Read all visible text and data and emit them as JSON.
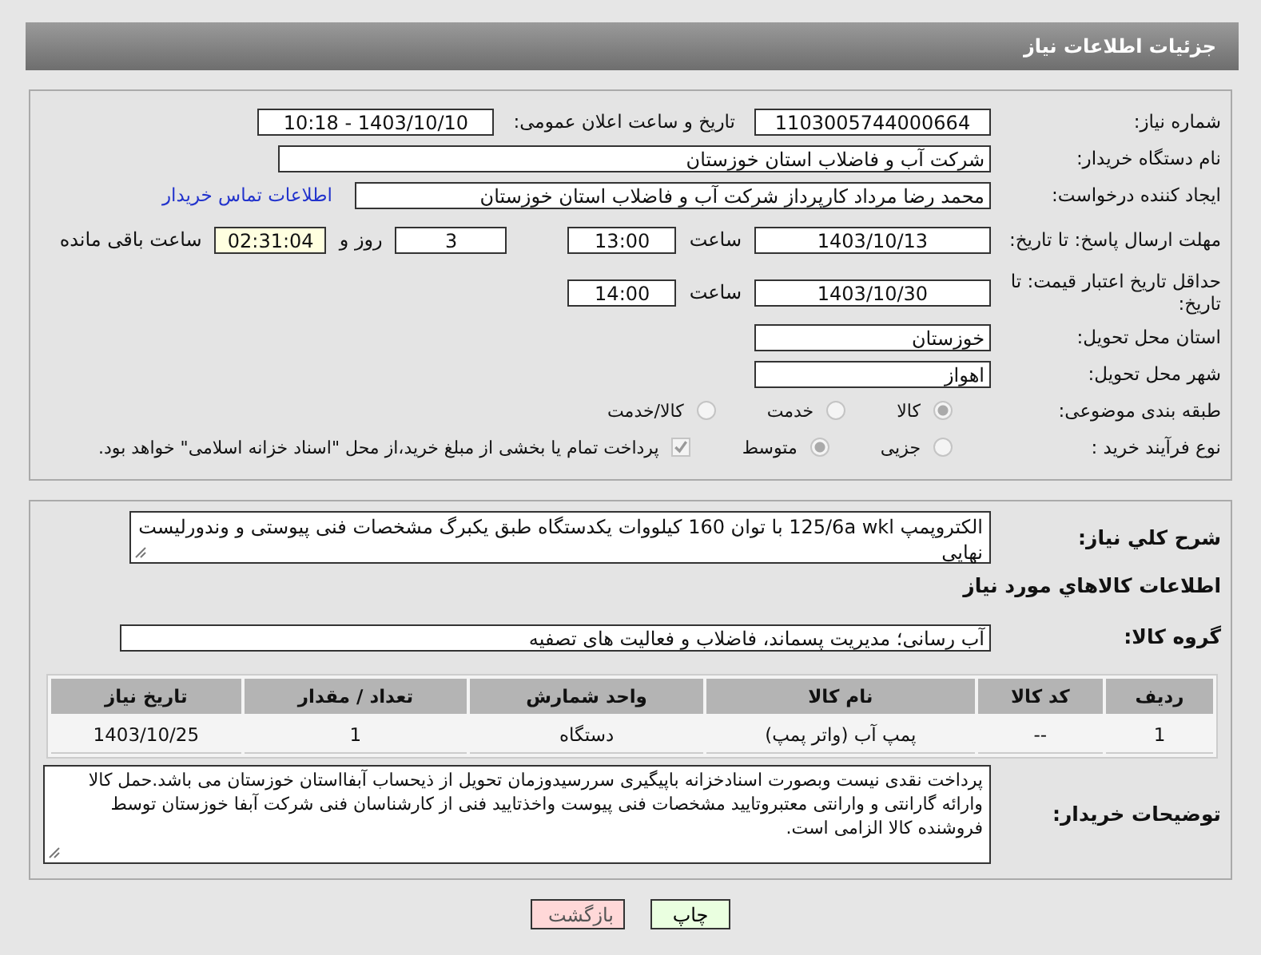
{
  "title": "جزئیات اطلاعات نیاز",
  "need_number": {
    "label": "شماره نیاز:",
    "value": "1103005744000664"
  },
  "announce": {
    "label": "تاریخ و ساعت اعلان عمومی:",
    "value": "1403/10/10 - 10:18"
  },
  "buyer_org": {
    "label": "نام دستگاه خریدار:",
    "value": "شرکت آب و فاضلاب استان خوزستان"
  },
  "requester": {
    "label": "ایجاد کننده درخواست:",
    "value": "محمد رضا مرداد کارپرداز شرکت آب و فاضلاب استان خوزستان",
    "link": "اطلاعات تماس خریدار"
  },
  "deadline": {
    "label": "مهلت ارسال پاسخ: تا تاریخ:",
    "date": "1403/10/13",
    "time_label": "ساعت",
    "time": "13:00",
    "days": "3",
    "days_label": "روز و",
    "remaining": "02:31:04",
    "remaining_label": "ساعت باقی مانده"
  },
  "validity": {
    "label": "حداقل تاریخ اعتبار قیمت: تا تاریخ:",
    "date": "1403/10/30",
    "time_label": "ساعت",
    "time": "14:00"
  },
  "province": {
    "label": "استان محل تحویل:",
    "value": "خوزستان"
  },
  "city": {
    "label": "شهر محل تحویل:",
    "value": "اهواز"
  },
  "category": {
    "label": "طبقه بندی موضوعی:",
    "options": [
      {
        "label": "کالا",
        "selected": true
      },
      {
        "label": "خدمت",
        "selected": false
      },
      {
        "label": "کالا/خدمت",
        "selected": false
      }
    ]
  },
  "process": {
    "label": "نوع فرآیند خرید :",
    "options": [
      {
        "label": "جزیی",
        "selected": false
      },
      {
        "label": "متوسط",
        "selected": true
      }
    ],
    "treasury": {
      "label": "پرداخت تمام یا بخشی از مبلغ خرید،از محل \"اسناد خزانه اسلامی\" خواهد بود.",
      "checked": true
    }
  },
  "description": {
    "label": "شرح کلي نياز:",
    "value": "الکتروپمپ 125/6a wkl با توان 160 کیلووات یکدستگاه طبق یکبرگ مشخصات فنی پیوستی و وندورلیست نهایی"
  },
  "goods_heading": "اطلاعات کالاهاي مورد نياز",
  "goods_group": {
    "label": "گروه کالا:",
    "value": "آب رسانی؛ مدیریت پسماند، فاضلاب و فعالیت های تصفیه"
  },
  "table": {
    "columns": [
      "ردیف",
      "کد کالا",
      "نام کالا",
      "واحد شمارش",
      "تعداد / مقدار",
      "تاریخ نیاز"
    ],
    "rows": [
      [
        "1",
        "--",
        "پمپ آب (واتر پمپ)",
        "دستگاه",
        "1",
        "1403/10/25"
      ]
    ]
  },
  "buyer_notes": {
    "label": "توضیحات خریدار:",
    "value": "پرداخت نقدی نیست وبصورت اسنادخزانه باپیگیری سررسیدوزمان تحویل از ذیحساب آبفااستان خوزستان می باشد.حمل کالا وارائه گارانتی و وارانتی معتبروتایید مشخصات فنی پیوست واخذتایید فنی از کارشناسان فنی شرکت آبفا خوزستان توسط فروشنده کالا الزامی است."
  },
  "buttons": [
    {
      "label": "چاپ",
      "kind": "print"
    },
    {
      "label": "بازگشت",
      "kind": "back"
    }
  ]
}
